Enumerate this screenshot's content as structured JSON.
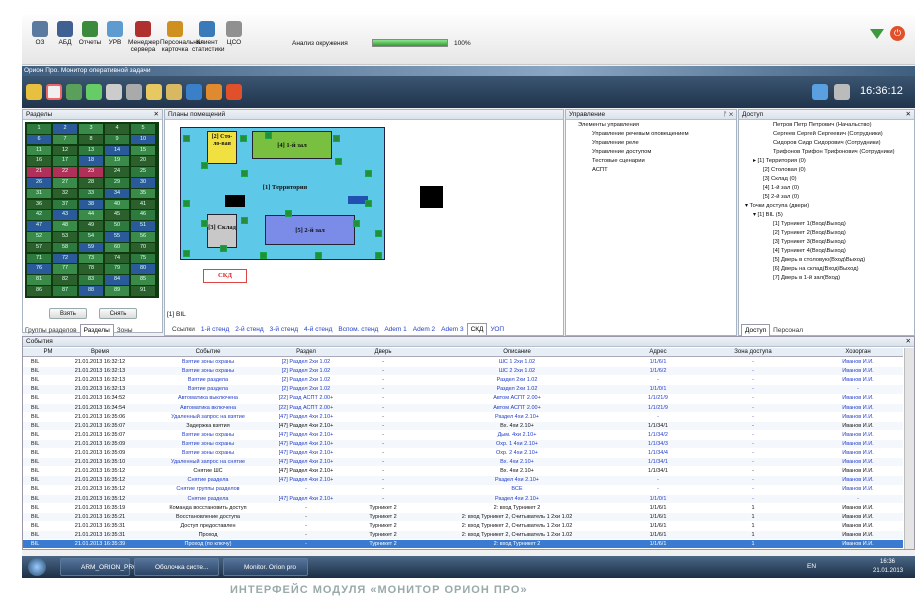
{
  "toolbar": [
    {
      "label": "ОЗ",
      "color": "#5a7aa0"
    },
    {
      "label": "АБД",
      "color": "#3f6090"
    },
    {
      "label": "Отчеты",
      "color": "#3c8a3c"
    },
    {
      "label": "УРВ",
      "color": "#5d9bd0"
    },
    {
      "label": "Менеджер сервера",
      "color": "#b03030"
    },
    {
      "label": "Персональная карточка",
      "color": "#d09020"
    },
    {
      "label": "Клиент статистики",
      "color": "#3a7ab8"
    },
    {
      "label": "ЦСО",
      "color": "#909090"
    }
  ],
  "analysis_label": "Анализ окружения",
  "analysis_pct": "100%",
  "analysis_progress": 1.0,
  "window_title": "Орион Про. Монитор оперативной задачи",
  "clock": "16:36:12",
  "left_panel": {
    "title": "Разделы",
    "btn1": "Взять",
    "btn2": "Снять",
    "tabs": [
      "Группы разделов",
      "Разделы",
      "Зоны"
    ]
  },
  "cells": [
    "1",
    "2",
    "3",
    "4",
    "5",
    "6",
    "7",
    "8",
    "9",
    "10",
    "11",
    "12",
    "13",
    "14",
    "15",
    "16",
    "17",
    "18",
    "19",
    "20",
    "21",
    "22",
    "23",
    "24",
    "25",
    "26",
    "27",
    "28",
    "29",
    "30",
    "31",
    "32",
    "33",
    "34",
    "35",
    "36",
    "37",
    "38",
    "40",
    "41",
    "42",
    "43",
    "44",
    "45",
    "46",
    "47",
    "48",
    "49",
    "50",
    "51",
    "52",
    "53",
    "54",
    "55",
    "56",
    "57",
    "58",
    "59",
    "60",
    "70",
    "71",
    "72",
    "73",
    "74",
    "75",
    "76",
    "77",
    "78",
    "79",
    "80",
    "81",
    "82",
    "83",
    "84",
    "85",
    "86",
    "87",
    "88",
    "89",
    "91"
  ],
  "plans": {
    "title": "Планы помещений",
    "breadcrumb": "[1] BIL",
    "rooms": {
      "canteen": "[2] Сто-ло-вая",
      "hall1": "[4] 1-й зал",
      "territory": "[1] Территория",
      "storage": "[3] Склад",
      "hall2": "[5] 2-й зал"
    },
    "skd": "СКД",
    "tabs": [
      "Ссылки",
      "1-й стенд",
      "2-й стенд",
      "3-й стенд",
      "4-й стенд",
      "Вспом. стенд",
      "Adem 1",
      "Adem 2",
      "Adem 3",
      "СКД",
      "УОП"
    ]
  },
  "control": {
    "title": "Управление",
    "items": [
      "Элементы управления",
      "Управление речевым оповещением",
      "Управление реле",
      "Управление доступом",
      "Тестовые сценарии",
      "АСПТ"
    ]
  },
  "access": {
    "title": "Доступ",
    "people": [
      "Петров Петр Петрович (Начальство)",
      "Сергеев Сергей Сергеевич (Сотрудники)",
      "Сидоров Сидр Сидорович (Сотрудники)",
      "Трифонов Трифон Трифонович (Сотрудники)"
    ],
    "zones": [
      "[1] Территория (0)",
      "[2] Столовая (0)",
      "[3] Склад (0)",
      "[4] 1-й зал (0)",
      "[5] 2-й зал (0)"
    ],
    "points_title": "Точки доступа (двери)",
    "points_root": "[1] BIL (5)",
    "points": [
      "[1] Турникет 1(Вход\\Выход)",
      "[2] Турникет 2(Вход\\Выход)",
      "[3] Турникет 3(Вход\\Выход)",
      "[4] Турникет 4(Вход\\Выход)",
      "[5] Дверь в столовую(Вход\\Выход)",
      "[6] Дверь на склад(Вход\\Выход)",
      "[7] Дверь в 1-й зал(Вход)"
    ],
    "tabs": [
      "Доступ",
      "Персонал"
    ]
  },
  "events": {
    "title": "События",
    "headers": [
      "РМ",
      "Время",
      "Событие",
      "Раздел",
      "Дверь",
      "Описание",
      "Адрес",
      "Зона доступа",
      "Хозорган"
    ],
    "rows": [
      [
        "BIL",
        "21.01.2013 16:32:12",
        "Взятие зоны охраны",
        "[2] Раздел 2хи 1.02",
        "-",
        "ШС 1 2хи 1.02",
        "1/1/6/1",
        "-",
        "Иванов И.И.",
        "b"
      ],
      [
        "BIL",
        "21.01.2013 16:32:13",
        "Взятие зоны охраны",
        "[2] Раздел 2хи 1.02",
        "-",
        "ШС 2 2хи 1.02",
        "1/1/6/2",
        "-",
        "Иванов И.И.",
        "b"
      ],
      [
        "BIL",
        "21.01.2013 16:32:13",
        "Взятие раздела",
        "[2] Раздел 2хи 1.02",
        "-",
        "Раздел 2хи 1.02",
        "-",
        "-",
        "Иванов И.И.",
        "b"
      ],
      [
        "BIL",
        "21.01.2013 16:32:13",
        "Взятие раздела",
        "[2] Раздел 2хи 1.02",
        "-",
        "Раздел 2хи 1.02",
        "1/1/0/1",
        "-",
        "-",
        "b"
      ],
      [
        "BIL",
        "21.01.2013 16:34:52",
        "Автоматика выключена",
        "[22] Разд АСПТ 2.00+",
        "-",
        "Автом АСПТ 2.00+",
        "1/1/21/9",
        "-",
        "Иванов И.И.",
        "b"
      ],
      [
        "BIL",
        "21.01.2013 16:34:54",
        "Автоматика включена",
        "[22] Разд АСПТ 2.00+",
        "-",
        "Автом АСПТ 2.00+",
        "1/1/21/9",
        "-",
        "Иванов И.И.",
        "b"
      ],
      [
        "BIL",
        "21.01.2013 16:35:06",
        "Удаленный запрос на взятие",
        "[47] Раздел 4хи 2.10+",
        "-",
        "Раздел 4хи 2.10+",
        "-",
        "-",
        "Иванов И.И.",
        "b"
      ],
      [
        "BIL",
        "21.01.2013 16:35:07",
        "Задержка взятия",
        "[47] Раздел 4хи 2.10+",
        "-",
        "Вх. 4хи 2.10+",
        "1/1/34/1",
        "-",
        "Иванов И.И.",
        "k"
      ],
      [
        "BIL",
        "21.01.2013 16:35:07",
        "Взятие зоны охраны",
        "[47] Раздел 4хи 2.10+",
        "-",
        "Дым. 4хи 2.10+",
        "1/1/34/2",
        "-",
        "Иванов И.И.",
        "b"
      ],
      [
        "BIL",
        "21.01.2013 16:35:09",
        "Взятие зоны охраны",
        "[47] Раздел 4хи 2.10+",
        "-",
        "Охр. 1 4хи 2.10+",
        "1/1/34/3",
        "-",
        "Иванов И.И.",
        "b"
      ],
      [
        "BIL",
        "21.01.2013 16:35:09",
        "Взятие зоны охраны",
        "[47] Раздел 4хи 2.10+",
        "-",
        "Охр. 2 4хи 2.10+",
        "1/1/34/4",
        "-",
        "Иванов И.И.",
        "b"
      ],
      [
        "BIL",
        "21.01.2013 16:35:10",
        "Удаленный запрос на снятие",
        "[47] Раздел 4хи 2.10+",
        "-",
        "Вх. 4хи 2.10+",
        "1/1/34/1",
        "-",
        "Иванов И.И.",
        "b"
      ],
      [
        "BIL",
        "21.01.2013 16:35:12",
        "Снятие ШС",
        "[47] Раздел 4хи 2.10+",
        "-",
        "Вх. 4хи 2.10+",
        "1/1/34/1",
        "-",
        "Иванов И.И.",
        "k"
      ],
      [
        "BIL",
        "21.01.2013 16:35:12",
        "Снятие раздела",
        "[47] Раздел 4хи 2.10+",
        "-",
        "Раздел 4хи 2.10+",
        "-",
        "-",
        "Иванов И.И.",
        "b"
      ],
      [
        "BIL",
        "21.01.2013 16:35:12",
        "Снятие группы разделов",
        "-",
        "-",
        "ВСЕ",
        "-",
        "-",
        "Иванов И.И.",
        "b"
      ],
      [
        "BIL",
        "21.01.2013 16:35:12",
        "Снятие раздела",
        "[47] Раздел 4хи 2.10+",
        "-",
        "Раздел 4хи 2.10+",
        "1/1/0/1",
        "-",
        "-",
        "b"
      ],
      [
        "BIL",
        "21.01.2013 16:35:19",
        "Команда восстановить доступ",
        "-",
        "Турникет 2",
        "2: вход   Турникет 2",
        "1/1/6/1",
        "1",
        "Иванов И.И.",
        "k"
      ],
      [
        "BIL",
        "21.01.2013 16:35:21",
        "Восстановление доступа",
        "-",
        "Турникет 2",
        "2: вход   Турникет 2, Считыватель 1 2хи 1.02",
        "1/1/6/1",
        "1",
        "Иванов И.И.",
        "k"
      ],
      [
        "BIL",
        "21.01.2013 16:35:31",
        "Доступ предоставлен",
        "-",
        "Турникет 2",
        "2: вход   Турникет 2, Считыватель 1 2хи 1.02",
        "1/1/6/1",
        "1",
        "Иванов И.И.",
        "k"
      ],
      [
        "BIL",
        "21.01.2013 16:35:31",
        "Проход",
        "-",
        "Турникет 2",
        "2: вход   Турникет 2, Считыватель 1 2хи 1.02",
        "1/1/6/1",
        "1",
        "Иванов И.И.",
        "k"
      ],
      [
        "BIL",
        "21.01.2013 16:35:39",
        "Проход (по ключу)",
        "-",
        "Турникет 2",
        "2: вход   Турникет 2",
        "1/1/6/1",
        "1",
        "Иванов И.И.",
        "s"
      ]
    ]
  },
  "taskbar": {
    "items": [
      "ARM_ORION_PRO",
      "Оболочка систе...",
      "Monitor. Orion pro"
    ],
    "lang": "EN",
    "time": "16:36",
    "date": "21.01.2013"
  },
  "caption": "ИНТЕРФЕЙС МОДУЛЯ «МОНИТОР ОРИОН ПРО»"
}
